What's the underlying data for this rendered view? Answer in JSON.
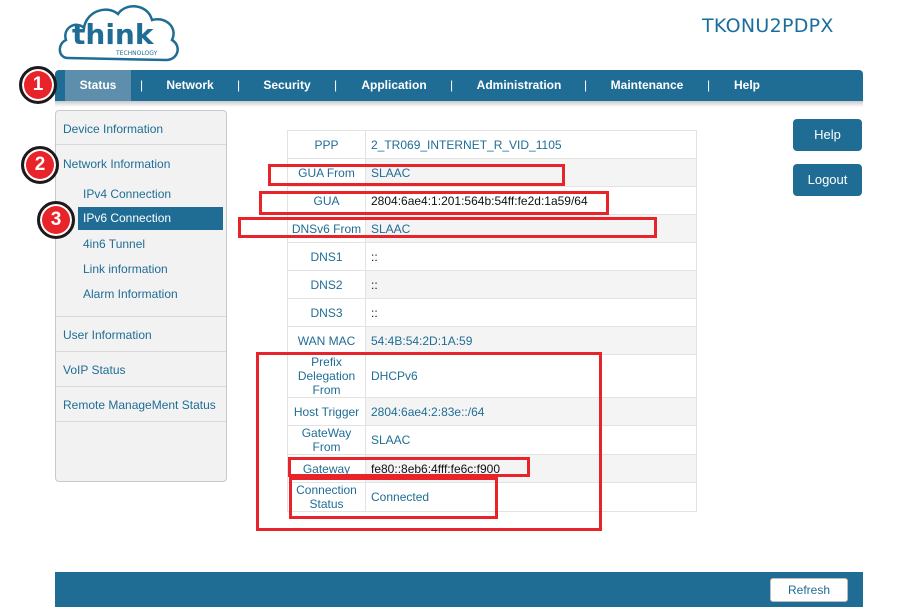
{
  "header": {
    "logo_text": "think",
    "logo_sub": "TECHNOLOGY",
    "device_name": "TKONU2PDPX"
  },
  "nav": {
    "items": [
      "Status",
      "Network",
      "Security",
      "Application",
      "Administration",
      "Maintenance",
      "Help"
    ],
    "separator": "|"
  },
  "badges": [
    "1",
    "2",
    "3"
  ],
  "sidebar": {
    "device_information": "Device Information",
    "network_information": "Network Information",
    "network_sub": [
      "IPv4 Connection",
      "IPv6 Connection",
      "4in6 Tunnel",
      "Link information",
      "Alarm Information"
    ],
    "user_information": "User Information",
    "voip_status": "VoIP Status",
    "remote_management": "Remote ManageMent Status"
  },
  "table": {
    "rows": [
      {
        "label": "PPP",
        "value": "2_TR069_INTERNET_R_VID_1105"
      },
      {
        "label": "GUA From",
        "value": "SLAAC"
      },
      {
        "label": "GUA",
        "value": "2804:6ae4:1:201:564b:54ff:fe2d:1a59/64"
      },
      {
        "label": "DNSv6 From",
        "value": "SLAAC"
      },
      {
        "label": "DNS1",
        "value": "::"
      },
      {
        "label": "DNS2",
        "value": "::"
      },
      {
        "label": "DNS3",
        "value": "::"
      },
      {
        "label": "WAN MAC",
        "value": "54:4B:54:2D:1A:59"
      },
      {
        "label": "Prefix Delegation From",
        "value": "DHCPv6"
      },
      {
        "label": "Host Trigger",
        "value": "2804:6ae4:2:83e::/64"
      },
      {
        "label": "GateWay From",
        "value": "SLAAC"
      },
      {
        "label": "Gateway",
        "value": "fe80::8eb6:4fff:fe6c:f900"
      },
      {
        "label": "Connection Status",
        "value": "Connected"
      }
    ]
  },
  "buttons": {
    "help": "Help",
    "logout": "Logout",
    "refresh": "Refresh"
  },
  "colors": {
    "brand": "#1f6d95",
    "highlight": "#e8232a"
  }
}
